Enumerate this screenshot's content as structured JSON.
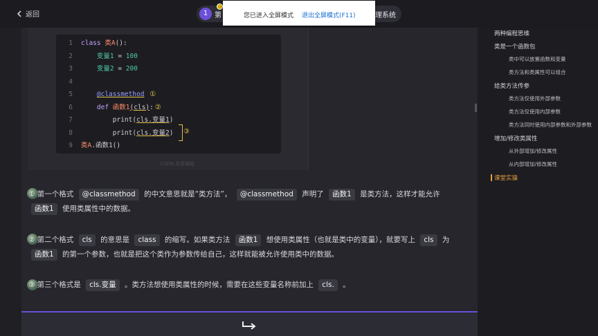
{
  "topbar": {
    "back_label": "返回",
    "lesson_number": "1",
    "lesson_title_left": "第",
    "lesson_title_right": "管理系统"
  },
  "fullscreen_notice": {
    "message": "您已进入全屏模式",
    "exit_label": "退出全屏模式(F11)"
  },
  "code": {
    "lines": [
      {
        "n": "1",
        "html": "<span class='kw'>class</span> <span class='cn'>类A</span>():"
      },
      {
        "n": "2",
        "html": "    <span class='nm'>变量1</span> = <span class='nm'>100</span>"
      },
      {
        "n": "3",
        "html": "    <span class='nm'>变量2</span> = <span class='nm'>200</span>"
      },
      {
        "n": "4",
        "html": ""
      },
      {
        "n": "5",
        "html": "    <span class='dec underline'>@classmethod</span> <span class='circ'>①</span>"
      },
      {
        "n": "6",
        "html": "    <span class='kw'>def</span> <span class='cn'>函数1</span><span class='underline'>(cls)</span>:<span class='circ'>②</span>"
      },
      {
        "n": "7",
        "html": "        print(<span class='underline'>cls.变量1</span>)"
      },
      {
        "n": "8",
        "html": "        print(<span class='underline'>cls.变量2</span>)"
      },
      {
        "n": "9",
        "html": "<span class='cn'>类A</span>.函数1()"
      }
    ],
    "bracket_label": "③",
    "watermark": "CSDN 风变编程"
  },
  "paragraphs": {
    "p1": {
      "num": "①",
      "t1": "第一个格式",
      "tag1": "@classmethod",
      "t2": "的中文意思就是“类方法”，",
      "tag2": "@classmethod",
      "t3": "声明了",
      "tag3": "函数1",
      "t4": "是类方法，这样才能允许",
      "tag4": "函数1",
      "t5": "使用类属性中的数据。"
    },
    "p2": {
      "num": "②",
      "t1": "第二个格式",
      "tag1": "cls",
      "t2": "的意思是",
      "tag2": "class",
      "t3": "的缩写。如果类方法",
      "tag3": "函数1",
      "t4": "想使用类属性（也就是类中的变量），就要写上",
      "tag4": "cls",
      "t5": "为",
      "tag5": "函数1",
      "t6": "的第一个参数，也就是把这个类作为参数传给自己，这样就能被允许使用类中的数据。"
    },
    "p3": {
      "num": "③",
      "t1": "第三个格式是",
      "tag1": "cls.变量",
      "t2": "。类方法想使用类属性的时候，需要在这些变量名称前加上",
      "tag2": "cls.",
      "t3": "。"
    }
  },
  "toc": {
    "items": [
      {
        "label": "两种编程思维",
        "level": 1
      },
      {
        "label": "类是一个函数包",
        "level": 1
      },
      {
        "label": "类中可以放置函数和变量",
        "level": 2
      },
      {
        "label": "类方法和类属性可以组合",
        "level": 2
      },
      {
        "label": "给类方法传参",
        "level": 1
      },
      {
        "label": "类方法仅使用外部参数",
        "level": 2
      },
      {
        "label": "类方法仅使用内部参数",
        "level": 2
      },
      {
        "label": "类方法同时使用内部参数和外部参数",
        "level": 2
      },
      {
        "label": "增加/修改类属性",
        "level": 1
      },
      {
        "label": "从外部增加/修改属性",
        "level": 2
      },
      {
        "label": "从内部增加/修改属性",
        "level": 2
      },
      {
        "label": "课堂实操",
        "level": 1,
        "active": true
      }
    ]
  },
  "colors": {
    "accent": "#6b4fd8",
    "active_toc": "#e6a03c",
    "highlight": "#e8c44a"
  },
  "icons": {
    "back": "chevron-left-icon",
    "enter": "enter-arrow-icon"
  }
}
